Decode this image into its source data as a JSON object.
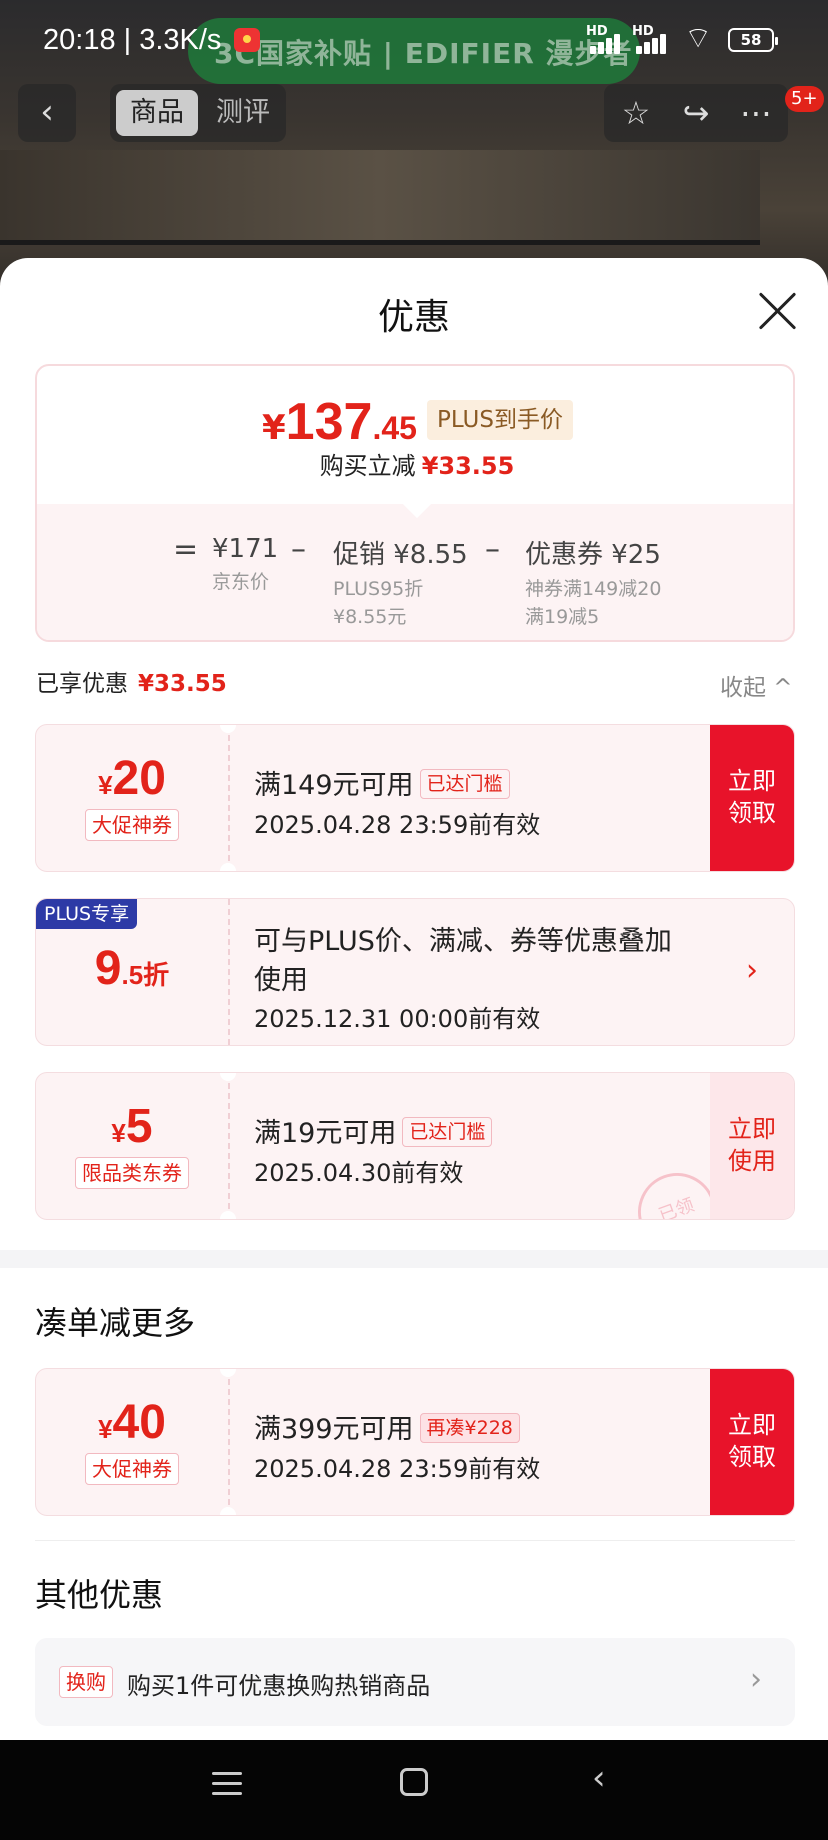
{
  "status_bar": {
    "time": "20:18 | 3.3K/s",
    "sig1": "HD",
    "sig2": "HD",
    "battery": "58"
  },
  "background_banner": "3C国家补贴 | EDIFIER 漫步者",
  "top_bar": {
    "tabs": [
      "商品",
      "测评"
    ],
    "badge": "5+"
  },
  "sheet": {
    "title": "优惠",
    "price_card": {
      "currency": "¥",
      "final_int": "137",
      "final_dec": ".45",
      "plus_tag": "PLUS到手价",
      "instant_label": "购买立减",
      "instant_value": "¥33.55",
      "formula": {
        "eq": "=",
        "jd_price": "¥171",
        "jd_price_label": "京东价",
        "minus1": "–",
        "promo": "促销 ¥8.55",
        "promo_sub1": "PLUS95折",
        "promo_sub2": "¥8.55元",
        "minus2": "–",
        "coupon": "优惠券 ¥25",
        "coupon_sub1": "神券满149减20",
        "coupon_sub2": "满19减5"
      }
    },
    "enjoyed_label": "已享优惠",
    "enjoyed_value": "¥33.55",
    "collapse": "收起 ^",
    "coupons": [
      {
        "yen": "¥",
        "amount": "20",
        "tag": "大促神券",
        "condition": "满149元可用",
        "threshold": "已达门槛",
        "valid": "2025.04.28 23:59前有效",
        "action_line1": "立即",
        "action_line2": "领取"
      },
      {
        "plus_label": "PLUS专享",
        "amount": "9",
        "amount_suffix": ".5折",
        "condition_line1": "可与PLUS价、满减、券等优惠叠加",
        "condition_line2": "使用",
        "valid": "2025.12.31 00:00前有效",
        "arrow": "›"
      },
      {
        "yen": "¥",
        "amount": "5",
        "tag": "限品类东券",
        "condition": "满19元可用",
        "threshold": "已达门槛",
        "valid": "2025.04.30前有效",
        "action_line1": "立即",
        "action_line2": "使用",
        "stamp": "已领"
      }
    ],
    "more_section": {
      "title": "凑单减更多",
      "coupon": {
        "yen": "¥",
        "amount": "40",
        "tag": "大促神券",
        "condition": "满399元可用",
        "threshold": "再凑¥228",
        "valid": "2025.04.28 23:59前有效",
        "action_line1": "立即",
        "action_line2": "领取"
      }
    },
    "other_section": {
      "title": "其他优惠",
      "item": {
        "tag": "换购",
        "text": "购买1件可优惠换购热销商品",
        "chev": "›"
      }
    }
  },
  "nav_bar": {
    "back": "‹"
  },
  "colors": {
    "accent": "#e2231a",
    "action_bg": "#e8132a",
    "coupon_bg": "#fdf3f4",
    "plus_blue": "#2d3aa6"
  }
}
